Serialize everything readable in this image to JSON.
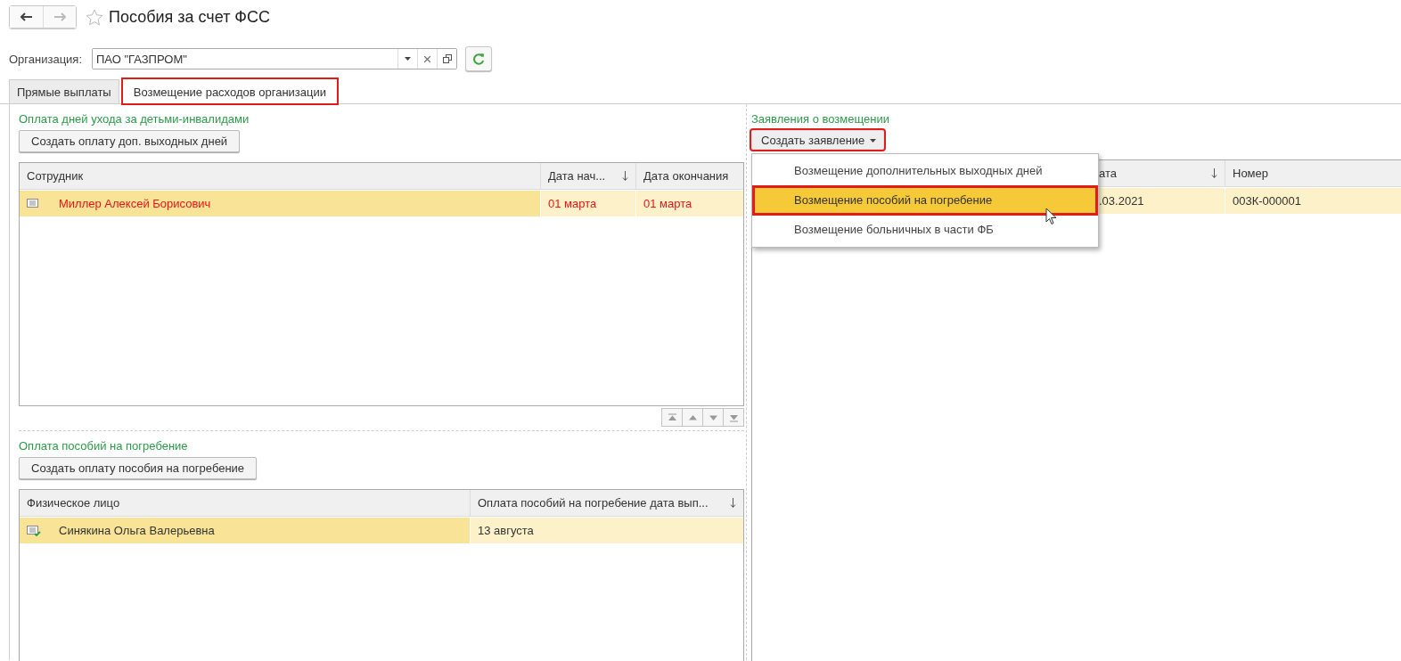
{
  "window": {
    "title": "Пособия за счет ФСС",
    "favorite": false
  },
  "nav": {
    "back_enabled": true,
    "forward_enabled": false
  },
  "organization": {
    "label": "Организация:",
    "value": "ПАО \"ГАЗПРОМ\""
  },
  "tabs": [
    {
      "label": "Прямые выплаты",
      "selected": false,
      "highlighted": false
    },
    {
      "label": "Возмещение расходов организации",
      "selected": true,
      "highlighted": true
    }
  ],
  "days_off": {
    "title": "Оплата дней ухода за детьми-инвалидами",
    "button": "Создать оплату доп. выходных дней",
    "table": {
      "columns": [
        {
          "label": "Сотрудник",
          "sorted": false
        },
        {
          "label": "Дата нач...",
          "sorted": true
        },
        {
          "label": "Дата окончания",
          "sorted": false
        }
      ],
      "rows": [
        {
          "cells": [
            "Миллер Алексей Борисович",
            "01 марта",
            "01 марта"
          ],
          "selected": true,
          "posted": false,
          "color": "#e8141a"
        }
      ]
    }
  },
  "burial": {
    "title": "Оплата пособий на погребение",
    "button": "Создать оплату пособия на погребение",
    "table": {
      "columns": [
        {
          "label": "Физическое лицо",
          "sorted": false
        },
        {
          "label": "Оплата пособий на погребение дата вып...",
          "sorted": true
        }
      ],
      "rows": [
        {
          "cells": [
            "Синякина Ольга Валерьевна",
            "13 августа"
          ],
          "selected": true,
          "posted": true,
          "color": "#333333"
        }
      ]
    }
  },
  "applications": {
    "title": "Заявления о возмещении",
    "button": {
      "label": "Создать заявление",
      "highlighted": true,
      "expanded": true
    },
    "table": {
      "columns": [
        {
          "label": "ата",
          "sorted": true
        },
        {
          "label": "Номер",
          "sorted": false
        }
      ],
      "rows": [
        {
          "cells": [
            ".03.2021",
            "003К-000001"
          ],
          "selected": true,
          "color": "#333333"
        }
      ]
    }
  },
  "menu": [
    {
      "label": "Возмещение дополнительных выходных дней",
      "selected": false,
      "highlighted": false
    },
    {
      "label": "Возмещение пособий на погребение",
      "selected": true,
      "highlighted": true
    },
    {
      "label": "Возмещение больничных в части ФБ",
      "selected": false,
      "highlighted": false
    }
  ]
}
